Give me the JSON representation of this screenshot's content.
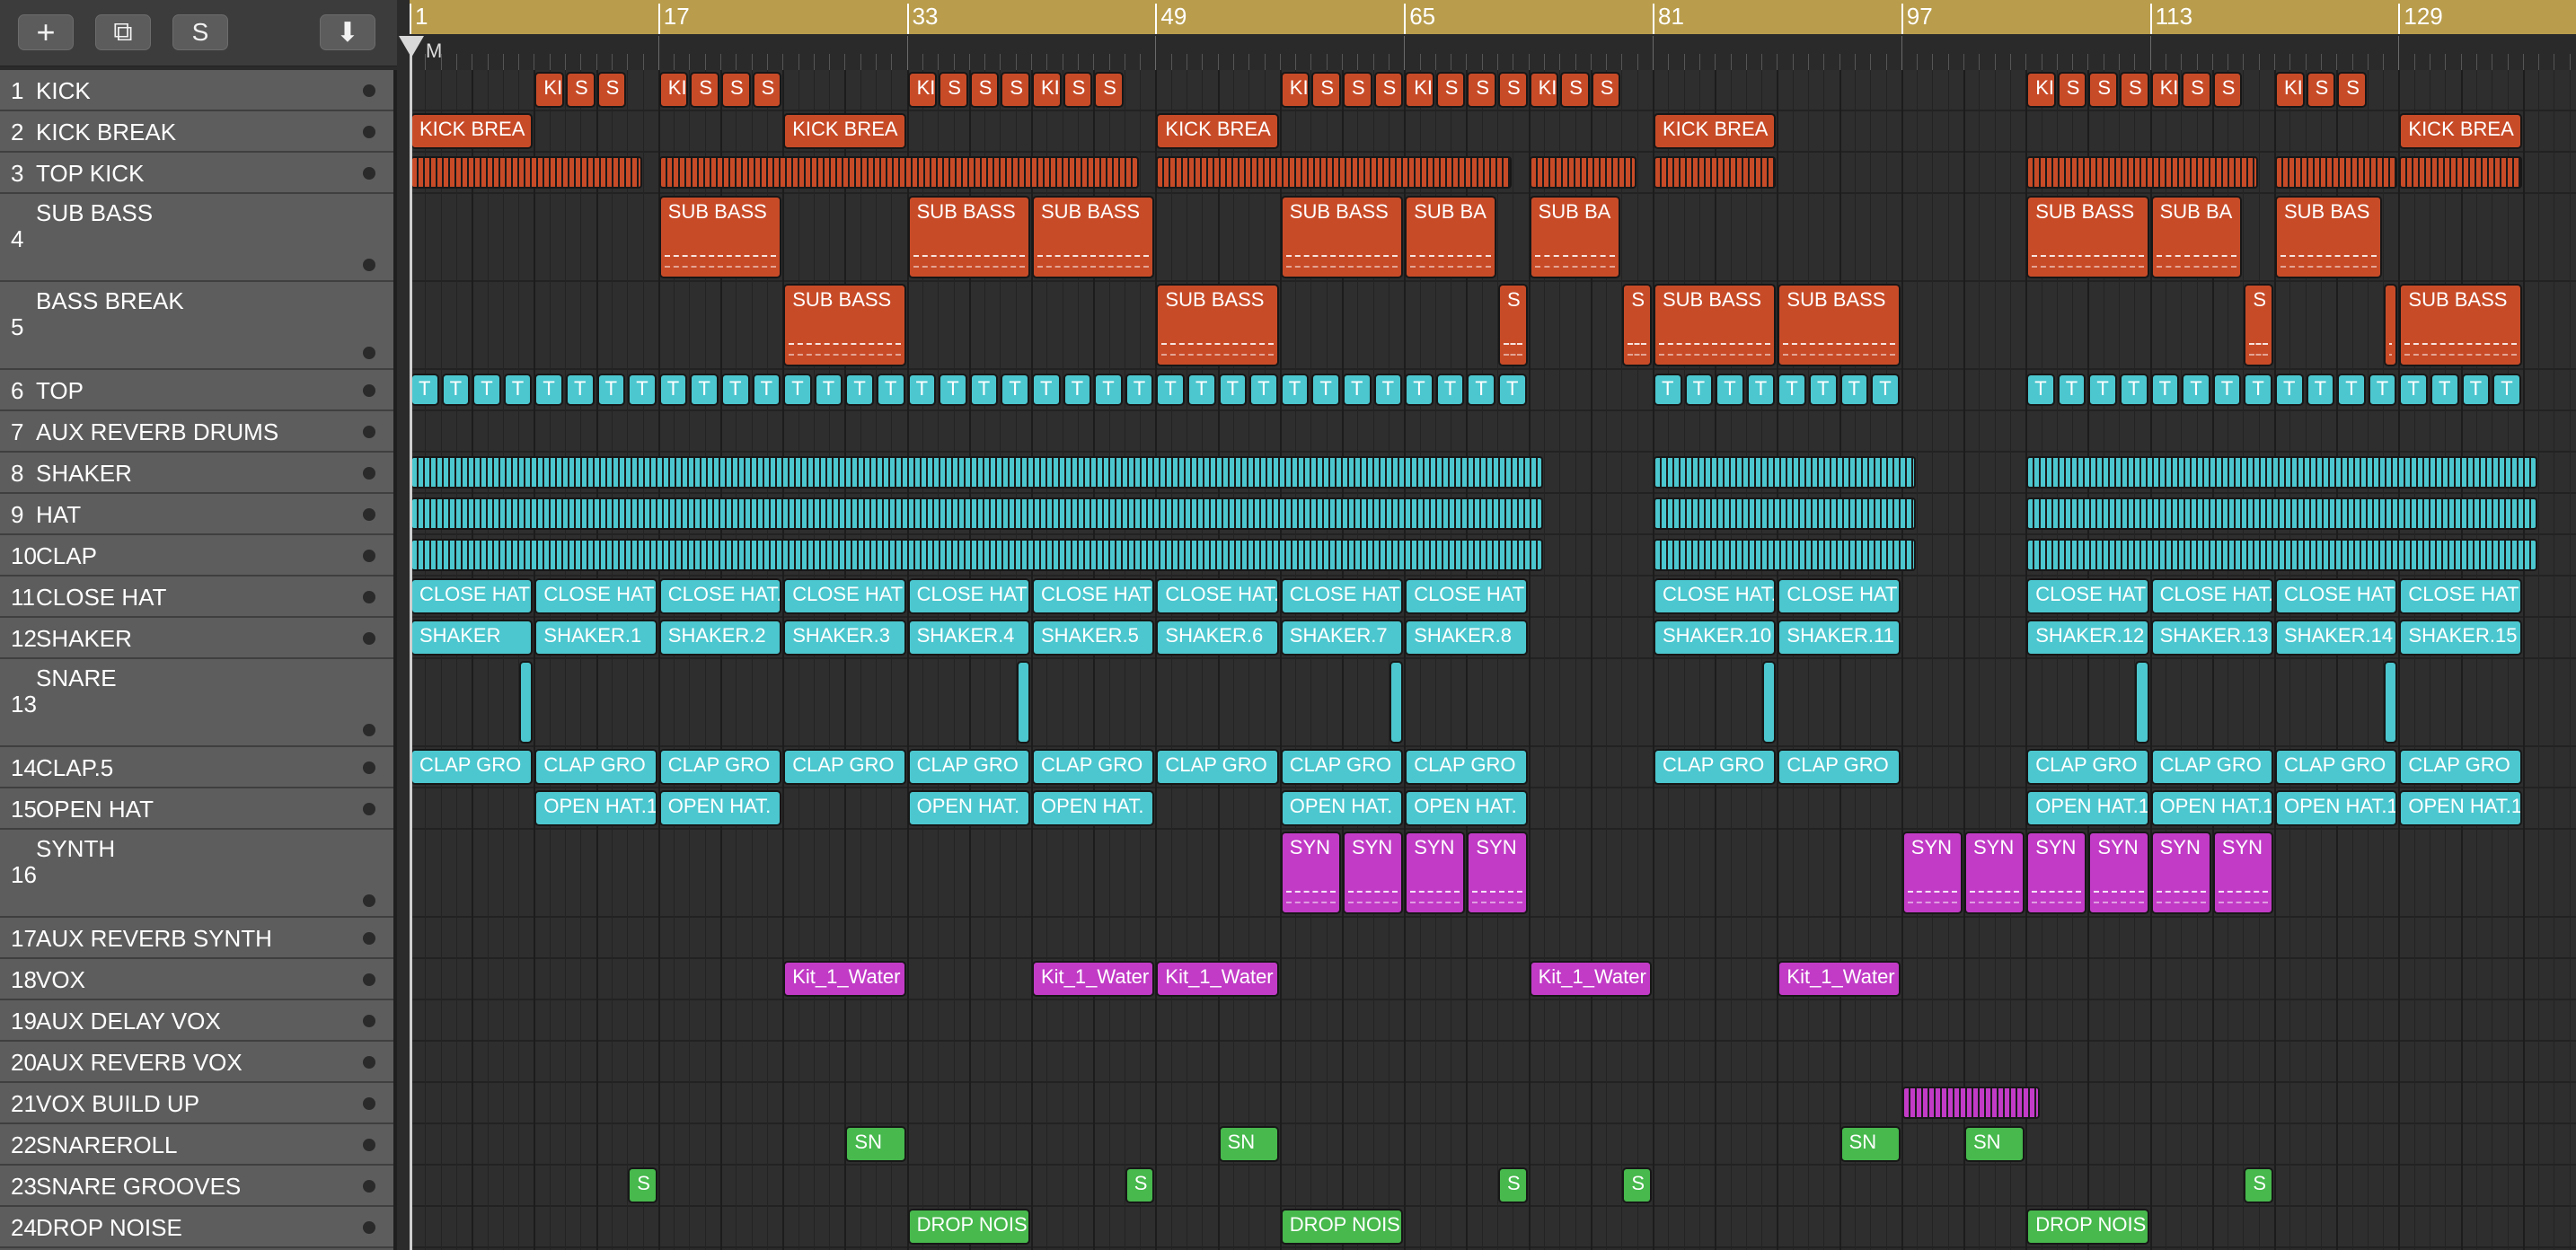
{
  "toolbar": {
    "add_label": "+",
    "duplicate_label": "⧉",
    "solo_label": "S",
    "catch_label": "⬇"
  },
  "ruler": {
    "bars": [
      "1",
      "17",
      "33",
      "49",
      "65",
      "81",
      "97",
      "113",
      "129"
    ],
    "marker_label": "M"
  },
  "colors": {
    "drums_red": "#c84b28",
    "perc_cyan": "#4cc7cf",
    "synth_magenta": "#c13bc6",
    "green": "#47b94d"
  },
  "tracks": [
    {
      "num": "1",
      "name": "KICK"
    },
    {
      "num": "2",
      "name": "KICK BREAK"
    },
    {
      "num": "3",
      "name": "TOP KICK"
    },
    {
      "num": "4",
      "name": "SUB BASS"
    },
    {
      "num": "5",
      "name": "BASS BREAK"
    },
    {
      "num": "6",
      "name": "TOP"
    },
    {
      "num": "7",
      "name": "AUX REVERB DRUMS"
    },
    {
      "num": "8",
      "name": "SHAKER"
    },
    {
      "num": "9",
      "name": "HAT"
    },
    {
      "num": "10",
      "name": "CLAP"
    },
    {
      "num": "11",
      "name": "CLOSE HAT"
    },
    {
      "num": "12",
      "name": "SHAKER"
    },
    {
      "num": "13",
      "name": "SNARE"
    },
    {
      "num": "14",
      "name": "CLAP.5"
    },
    {
      "num": "15",
      "name": "OPEN HAT"
    },
    {
      "num": "16",
      "name": "SYNTH"
    },
    {
      "num": "17",
      "name": "AUX REVERB SYNTH"
    },
    {
      "num": "18",
      "name": "VOX"
    },
    {
      "num": "19",
      "name": "AUX DELAY VOX"
    },
    {
      "num": "20",
      "name": "AUX REVERB VOX"
    },
    {
      "num": "21",
      "name": "VOX BUILD UP"
    },
    {
      "num": "22",
      "name": "SNAREROLL"
    },
    {
      "num": "23",
      "name": "SNARE GROOVES"
    },
    {
      "num": "24",
      "name": "DROP NOISE"
    }
  ],
  "regions": [
    {
      "t": 1,
      "c": "red",
      "bar": 9,
      "len": 2,
      "label": "KI"
    },
    {
      "t": 1,
      "c": "red",
      "bar": 11,
      "len": 2,
      "label": "S"
    },
    {
      "t": 1,
      "c": "red",
      "bar": 13,
      "len": 2,
      "label": "S"
    },
    {
      "t": 1,
      "c": "red",
      "bar": 17,
      "len": 2,
      "label": "KI"
    },
    {
      "t": 1,
      "c": "red",
      "bar": 19,
      "len": 2,
      "label": "S"
    },
    {
      "t": 1,
      "c": "red",
      "bar": 21,
      "len": 2,
      "label": "S"
    },
    {
      "t": 1,
      "c": "red",
      "bar": 23,
      "len": 2,
      "label": "S"
    },
    {
      "t": 1,
      "c": "red",
      "bar": 33,
      "len": 2,
      "label": "KI"
    },
    {
      "t": 1,
      "c": "red",
      "bar": 35,
      "len": 2,
      "label": "S"
    },
    {
      "t": 1,
      "c": "red",
      "bar": 37,
      "len": 2,
      "label": "S"
    },
    {
      "t": 1,
      "c": "red",
      "bar": 39,
      "len": 2,
      "label": "S"
    },
    {
      "t": 1,
      "c": "red",
      "bar": 41,
      "len": 2,
      "label": "KI"
    },
    {
      "t": 1,
      "c": "red",
      "bar": 43,
      "len": 2,
      "label": "S"
    },
    {
      "t": 1,
      "c": "red",
      "bar": 45,
      "len": 2,
      "label": "S"
    },
    {
      "t": 1,
      "c": "red",
      "bar": 57,
      "len": 2,
      "label": "KI"
    },
    {
      "t": 1,
      "c": "red",
      "bar": 59,
      "len": 2,
      "label": "S"
    },
    {
      "t": 1,
      "c": "red",
      "bar": 61,
      "len": 2,
      "label": "S"
    },
    {
      "t": 1,
      "c": "red",
      "bar": 63,
      "len": 2,
      "label": "S"
    },
    {
      "t": 1,
      "c": "red",
      "bar": 65,
      "len": 2,
      "label": "KI"
    },
    {
      "t": 1,
      "c": "red",
      "bar": 67,
      "len": 2,
      "label": "S"
    },
    {
      "t": 1,
      "c": "red",
      "bar": 69,
      "len": 2,
      "label": "S"
    },
    {
      "t": 1,
      "c": "red",
      "bar": 71,
      "len": 2,
      "label": "S"
    },
    {
      "t": 1,
      "c": "red",
      "bar": 73,
      "len": 2,
      "label": "KI"
    },
    {
      "t": 1,
      "c": "red",
      "bar": 75,
      "len": 2,
      "label": "S"
    },
    {
      "t": 1,
      "c": "red",
      "bar": 77,
      "len": 2,
      "label": "S"
    },
    {
      "t": 1,
      "c": "red",
      "bar": 105,
      "len": 2,
      "label": "KI"
    },
    {
      "t": 1,
      "c": "red",
      "bar": 107,
      "len": 2,
      "label": "S"
    },
    {
      "t": 1,
      "c": "red",
      "bar": 109,
      "len": 2,
      "label": "S"
    },
    {
      "t": 1,
      "c": "red",
      "bar": 111,
      "len": 2,
      "label": "S"
    },
    {
      "t": 1,
      "c": "red",
      "bar": 113,
      "len": 2,
      "label": "KI"
    },
    {
      "t": 1,
      "c": "red",
      "bar": 115,
      "len": 2,
      "label": "S"
    },
    {
      "t": 1,
      "c": "red",
      "bar": 117,
      "len": 2,
      "label": "S"
    },
    {
      "t": 1,
      "c": "red",
      "bar": 121,
      "len": 2,
      "label": "KI"
    },
    {
      "t": 1,
      "c": "red",
      "bar": 123,
      "len": 2,
      "label": "S"
    },
    {
      "t": 1,
      "c": "red",
      "bar": 125,
      "len": 2,
      "label": "S"
    },
    {
      "t": 2,
      "c": "red",
      "bar": 1,
      "len": 8,
      "label": "KICK BREA"
    },
    {
      "t": 2,
      "c": "red",
      "bar": 25,
      "len": 8,
      "label": "KICK BREA"
    },
    {
      "t": 2,
      "c": "red",
      "bar": 49,
      "len": 8,
      "label": "KICK BREA"
    },
    {
      "t": 2,
      "c": "red",
      "bar": 81,
      "len": 8,
      "label": "KICK BREA"
    },
    {
      "t": 2,
      "c": "red",
      "bar": 129,
      "len": 8,
      "label": "KICK BREA"
    },
    {
      "t": 4,
      "c": "red",
      "bar": 17,
      "len": 8,
      "label": "SUB BASS",
      "pat": true
    },
    {
      "t": 4,
      "c": "red",
      "bar": 33,
      "len": 8,
      "label": "SUB BASS",
      "pat": true
    },
    {
      "t": 4,
      "c": "red",
      "bar": 41,
      "len": 8,
      "label": "SUB BASS",
      "pat": true
    },
    {
      "t": 4,
      "c": "red",
      "bar": 57,
      "len": 8,
      "label": "SUB BASS",
      "pat": true
    },
    {
      "t": 4,
      "c": "red",
      "bar": 65,
      "len": 6,
      "label": "SUB BA",
      "pat": true
    },
    {
      "t": 4,
      "c": "red",
      "bar": 73,
      "len": 6,
      "label": "SUB BA",
      "pat": true
    },
    {
      "t": 4,
      "c": "red",
      "bar": 105,
      "len": 8,
      "label": "SUB BASS",
      "pat": true
    },
    {
      "t": 4,
      "c": "red",
      "bar": 113,
      "len": 6,
      "label": "SUB BA",
      "pat": true
    },
    {
      "t": 4,
      "c": "red",
      "bar": 121,
      "len": 7,
      "label": "SUB BAS",
      "pat": true
    },
    {
      "t": 5,
      "c": "red",
      "bar": 25,
      "len": 8,
      "label": "SUB BASS",
      "pat": true
    },
    {
      "t": 5,
      "c": "red",
      "bar": 49,
      "len": 8,
      "label": "SUB BASS",
      "pat": true
    },
    {
      "t": 5,
      "c": "red",
      "bar": 71,
      "len": 2,
      "label": "S",
      "pat": true
    },
    {
      "t": 5,
      "c": "red",
      "bar": 79,
      "len": 2,
      "label": "S",
      "pat": true
    },
    {
      "t": 5,
      "c": "red",
      "bar": 81,
      "len": 8,
      "label": "SUB BASS",
      "pat": true
    },
    {
      "t": 5,
      "c": "red",
      "bar": 89,
      "len": 8,
      "label": "SUB BASS",
      "pat": true
    },
    {
      "t": 5,
      "c": "red",
      "bar": 119,
      "len": 2,
      "label": "S",
      "pat": true
    },
    {
      "t": 5,
      "c": "red",
      "bar": 128,
      "len": 1,
      "label": "",
      "pat": true
    },
    {
      "t": 5,
      "c": "red",
      "bar": 129,
      "len": 8,
      "label": "SUB BASS",
      "pat": true
    },
    {
      "t": 11,
      "c": "cyan",
      "bar": 1,
      "len": 8,
      "label": "CLOSE HAT"
    },
    {
      "t": 11,
      "c": "cyan",
      "bar": 9,
      "len": 8,
      "label": "CLOSE HAT"
    },
    {
      "t": 11,
      "c": "cyan",
      "bar": 17,
      "len": 8,
      "label": "CLOSE HAT."
    },
    {
      "t": 11,
      "c": "cyan",
      "bar": 25,
      "len": 8,
      "label": "CLOSE HAT"
    },
    {
      "t": 11,
      "c": "cyan",
      "bar": 33,
      "len": 8,
      "label": "CLOSE HAT"
    },
    {
      "t": 11,
      "c": "cyan",
      "bar": 41,
      "len": 8,
      "label": "CLOSE HAT"
    },
    {
      "t": 11,
      "c": "cyan",
      "bar": 49,
      "len": 8,
      "label": "CLOSE HAT."
    },
    {
      "t": 11,
      "c": "cyan",
      "bar": 57,
      "len": 8,
      "label": "CLOSE HAT"
    },
    {
      "t": 11,
      "c": "cyan",
      "bar": 65,
      "len": 8,
      "label": "CLOSE HAT"
    },
    {
      "t": 11,
      "c": "cyan",
      "bar": 81,
      "len": 8,
      "label": "CLOSE HAT."
    },
    {
      "t": 11,
      "c": "cyan",
      "bar": 89,
      "len": 8,
      "label": "CLOSE HAT"
    },
    {
      "t": 11,
      "c": "cyan",
      "bar": 105,
      "len": 8,
      "label": "CLOSE HAT"
    },
    {
      "t": 11,
      "c": "cyan",
      "bar": 113,
      "len": 8,
      "label": "CLOSE HAT."
    },
    {
      "t": 11,
      "c": "cyan",
      "bar": 121,
      "len": 8,
      "label": "CLOSE HAT"
    },
    {
      "t": 11,
      "c": "cyan",
      "bar": 129,
      "len": 8,
      "label": "CLOSE HAT"
    },
    {
      "t": 12,
      "c": "cyan",
      "bar": 1,
      "len": 8,
      "label": "SHAKER"
    },
    {
      "t": 12,
      "c": "cyan",
      "bar": 9,
      "len": 8,
      "label": "SHAKER.1"
    },
    {
      "t": 12,
      "c": "cyan",
      "bar": 17,
      "len": 8,
      "label": "SHAKER.2"
    },
    {
      "t": 12,
      "c": "cyan",
      "bar": 25,
      "len": 8,
      "label": "SHAKER.3"
    },
    {
      "t": 12,
      "c": "cyan",
      "bar": 33,
      "len": 8,
      "label": "SHAKER.4"
    },
    {
      "t": 12,
      "c": "cyan",
      "bar": 41,
      "len": 8,
      "label": "SHAKER.5"
    },
    {
      "t": 12,
      "c": "cyan",
      "bar": 49,
      "len": 8,
      "label": "SHAKER.6"
    },
    {
      "t": 12,
      "c": "cyan",
      "bar": 57,
      "len": 8,
      "label": "SHAKER.7"
    },
    {
      "t": 12,
      "c": "cyan",
      "bar": 65,
      "len": 8,
      "label": "SHAKER.8"
    },
    {
      "t": 12,
      "c": "cyan",
      "bar": 81,
      "len": 8,
      "label": "SHAKER.10"
    },
    {
      "t": 12,
      "c": "cyan",
      "bar": 89,
      "len": 8,
      "label": "SHAKER.11"
    },
    {
      "t": 12,
      "c": "cyan",
      "bar": 105,
      "len": 8,
      "label": "SHAKER.12"
    },
    {
      "t": 12,
      "c": "cyan",
      "bar": 113,
      "len": 8,
      "label": "SHAKER.13"
    },
    {
      "t": 12,
      "c": "cyan",
      "bar": 121,
      "len": 8,
      "label": "SHAKER.14"
    },
    {
      "t": 12,
      "c": "cyan",
      "bar": 129,
      "len": 8,
      "label": "SHAKER.15"
    },
    {
      "t": 13,
      "c": "cyan",
      "bar": 8,
      "len": 1,
      "label": ""
    },
    {
      "t": 13,
      "c": "cyan",
      "bar": 40,
      "len": 1,
      "label": ""
    },
    {
      "t": 13,
      "c": "cyan",
      "bar": 64,
      "len": 1,
      "label": ""
    },
    {
      "t": 13,
      "c": "cyan",
      "bar": 88,
      "len": 1,
      "label": ""
    },
    {
      "t": 13,
      "c": "cyan",
      "bar": 112,
      "len": 1,
      "label": ""
    },
    {
      "t": 13,
      "c": "cyan",
      "bar": 128,
      "len": 1,
      "label": ""
    },
    {
      "t": 14,
      "c": "cyan",
      "bar": 1,
      "len": 8,
      "label": "CLAP GRO"
    },
    {
      "t": 14,
      "c": "cyan",
      "bar": 9,
      "len": 8,
      "label": "CLAP GRO"
    },
    {
      "t": 14,
      "c": "cyan",
      "bar": 17,
      "len": 8,
      "label": "CLAP GRO"
    },
    {
      "t": 14,
      "c": "cyan",
      "bar": 25,
      "len": 8,
      "label": "CLAP GRO"
    },
    {
      "t": 14,
      "c": "cyan",
      "bar": 33,
      "len": 8,
      "label": "CLAP GRO"
    },
    {
      "t": 14,
      "c": "cyan",
      "bar": 41,
      "len": 8,
      "label": "CLAP GRO"
    },
    {
      "t": 14,
      "c": "cyan",
      "bar": 49,
      "len": 8,
      "label": "CLAP GRO"
    },
    {
      "t": 14,
      "c": "cyan",
      "bar": 57,
      "len": 8,
      "label": "CLAP GRO"
    },
    {
      "t": 14,
      "c": "cyan",
      "bar": 65,
      "len": 8,
      "label": "CLAP GRO"
    },
    {
      "t": 14,
      "c": "cyan",
      "bar": 81,
      "len": 8,
      "label": "CLAP GRO"
    },
    {
      "t": 14,
      "c": "cyan",
      "bar": 89,
      "len": 8,
      "label": "CLAP GRO"
    },
    {
      "t": 14,
      "c": "cyan",
      "bar": 105,
      "len": 8,
      "label": "CLAP GRO"
    },
    {
      "t": 14,
      "c": "cyan",
      "bar": 113,
      "len": 8,
      "label": "CLAP GRO"
    },
    {
      "t": 14,
      "c": "cyan",
      "bar": 121,
      "len": 8,
      "label": "CLAP GRO"
    },
    {
      "t": 14,
      "c": "cyan",
      "bar": 129,
      "len": 8,
      "label": "CLAP GRO"
    },
    {
      "t": 15,
      "c": "cyan",
      "bar": 9,
      "len": 8,
      "label": "OPEN HAT.1"
    },
    {
      "t": 15,
      "c": "cyan",
      "bar": 17,
      "len": 8,
      "label": "OPEN HAT."
    },
    {
      "t": 15,
      "c": "cyan",
      "bar": 33,
      "len": 8,
      "label": "OPEN HAT."
    },
    {
      "t": 15,
      "c": "cyan",
      "bar": 41,
      "len": 8,
      "label": "OPEN HAT."
    },
    {
      "t": 15,
      "c": "cyan",
      "bar": 57,
      "len": 8,
      "label": "OPEN HAT."
    },
    {
      "t": 15,
      "c": "cyan",
      "bar": 65,
      "len": 8,
      "label": "OPEN HAT."
    },
    {
      "t": 15,
      "c": "cyan",
      "bar": 105,
      "len": 8,
      "label": "OPEN HAT.1"
    },
    {
      "t": 15,
      "c": "cyan",
      "bar": 113,
      "len": 8,
      "label": "OPEN HAT.1"
    },
    {
      "t": 15,
      "c": "cyan",
      "bar": 121,
      "len": 8,
      "label": "OPEN HAT.1"
    },
    {
      "t": 15,
      "c": "cyan",
      "bar": 129,
      "len": 8,
      "label": "OPEN HAT.1"
    },
    {
      "t": 16,
      "c": "mag",
      "bar": 57,
      "len": 4,
      "label": "SYN",
      "pat": true
    },
    {
      "t": 16,
      "c": "mag",
      "bar": 61,
      "len": 4,
      "label": "SYN",
      "pat": true
    },
    {
      "t": 16,
      "c": "mag",
      "bar": 65,
      "len": 4,
      "label": "SYN",
      "pat": true
    },
    {
      "t": 16,
      "c": "mag",
      "bar": 69,
      "len": 4,
      "label": "SYN",
      "pat": true
    },
    {
      "t": 16,
      "c": "mag",
      "bar": 97,
      "len": 4,
      "label": "SYN",
      "pat": true
    },
    {
      "t": 16,
      "c": "mag",
      "bar": 101,
      "len": 4,
      "label": "SYN",
      "pat": true
    },
    {
      "t": 16,
      "c": "mag",
      "bar": 105,
      "len": 4,
      "label": "SYN",
      "pat": true
    },
    {
      "t": 16,
      "c": "mag",
      "bar": 109,
      "len": 4,
      "label": "SYN",
      "pat": true
    },
    {
      "t": 16,
      "c": "mag",
      "bar": 113,
      "len": 4,
      "label": "SYN",
      "pat": true
    },
    {
      "t": 16,
      "c": "mag",
      "bar": 117,
      "len": 4,
      "label": "SYN",
      "pat": true
    },
    {
      "t": 18,
      "c": "mag",
      "bar": 25,
      "len": 8,
      "label": "Kit_1_Water"
    },
    {
      "t": 18,
      "c": "mag",
      "bar": 41,
      "len": 8,
      "label": "Kit_1_Water"
    },
    {
      "t": 18,
      "c": "mag",
      "bar": 49,
      "len": 8,
      "label": "Kit_1_Water"
    },
    {
      "t": 18,
      "c": "mag",
      "bar": 73,
      "len": 8,
      "label": "Kit_1_Water"
    },
    {
      "t": 18,
      "c": "mag",
      "bar": 89,
      "len": 8,
      "label": "Kit_1_Water"
    },
    {
      "t": 22,
      "c": "green",
      "bar": 29,
      "len": 4,
      "label": "SN"
    },
    {
      "t": 22,
      "c": "green",
      "bar": 53,
      "len": 4,
      "label": "SN"
    },
    {
      "t": 22,
      "c": "green",
      "bar": 93,
      "len": 4,
      "label": "SN"
    },
    {
      "t": 22,
      "c": "green",
      "bar": 101,
      "len": 4,
      "label": "SN"
    },
    {
      "t": 23,
      "c": "green",
      "bar": 15,
      "len": 2,
      "label": "S"
    },
    {
      "t": 23,
      "c": "green",
      "bar": 47,
      "len": 2,
      "label": "S"
    },
    {
      "t": 23,
      "c": "green",
      "bar": 71,
      "len": 2,
      "label": "S"
    },
    {
      "t": 23,
      "c": "green",
      "bar": 79,
      "len": 2,
      "label": "S"
    },
    {
      "t": 23,
      "c": "green",
      "bar": 119,
      "len": 2,
      "label": "S"
    },
    {
      "t": 24,
      "c": "green",
      "bar": 33,
      "len": 8,
      "label": "DROP NOIS"
    },
    {
      "t": 24,
      "c": "green",
      "bar": 57,
      "len": 8,
      "label": "DROP NOIS"
    },
    {
      "t": 24,
      "c": "green",
      "bar": 105,
      "len": 8,
      "label": "DROP NOIS"
    }
  ],
  "stripe_regions": [
    {
      "t": 3,
      "c": "red",
      "bar": 1,
      "len": 15
    },
    {
      "t": 3,
      "c": "red",
      "bar": 17,
      "len": 31
    },
    {
      "t": 3,
      "c": "red",
      "bar": 49,
      "len": 23
    },
    {
      "t": 3,
      "c": "red",
      "bar": 73,
      "len": 7
    },
    {
      "t": 3,
      "c": "red",
      "bar": 81,
      "len": 8
    },
    {
      "t": 3,
      "c": "red",
      "bar": 105,
      "len": 15
    },
    {
      "t": 3,
      "c": "red",
      "bar": 121,
      "len": 8
    },
    {
      "t": 3,
      "c": "red",
      "bar": 129,
      "len": 8
    },
    {
      "t": 8,
      "c": "cyan",
      "bar": 1,
      "len": 73
    },
    {
      "t": 8,
      "c": "cyan",
      "bar": 81,
      "len": 17
    },
    {
      "t": 8,
      "c": "cyan",
      "bar": 105,
      "len": 33
    },
    {
      "t": 9,
      "c": "cyan",
      "bar": 1,
      "len": 73
    },
    {
      "t": 9,
      "c": "cyan",
      "bar": 81,
      "len": 17
    },
    {
      "t": 9,
      "c": "cyan",
      "bar": 105,
      "len": 33
    },
    {
      "t": 10,
      "c": "cyan",
      "bar": 1,
      "len": 73
    },
    {
      "t": 10,
      "c": "cyan",
      "bar": 81,
      "len": 17
    },
    {
      "t": 10,
      "c": "cyan",
      "bar": 105,
      "len": 33
    },
    {
      "t": 21,
      "c": "mag",
      "bar": 97,
      "len": 9
    }
  ],
  "top_clip_rows": [
    {
      "t": 6,
      "bar": 1,
      "count": 36,
      "label": "T"
    },
    {
      "t": 6,
      "bar": 81,
      "count": 8,
      "label": "T"
    },
    {
      "t": 6,
      "bar": 105,
      "count": 16,
      "label": "T"
    }
  ]
}
